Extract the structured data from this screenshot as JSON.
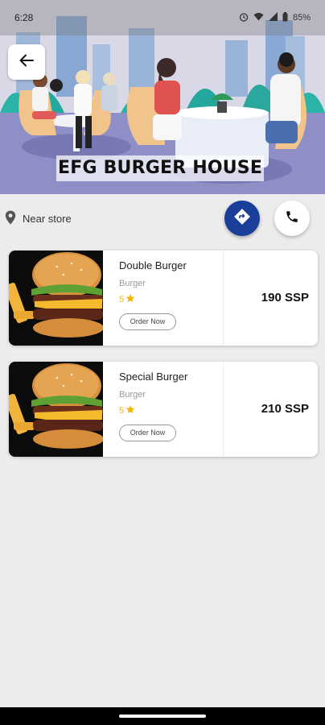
{
  "status_bar": {
    "time": "6:28",
    "battery": "85%"
  },
  "header": {
    "title": "EFG BURGER HOUSE"
  },
  "location": {
    "label": "Near store"
  },
  "items": [
    {
      "name": "Double Burger",
      "category": "Burger",
      "rating": "5",
      "order_label": "Order Now",
      "price": "190 SSP"
    },
    {
      "name": "Special Burger",
      "category": "Burger",
      "rating": "5",
      "order_label": "Order Now",
      "price": "210 SSP"
    }
  ],
  "colors": {
    "accent": "#1a3f9a",
    "star": "#f3b400",
    "background": "#ececec"
  }
}
